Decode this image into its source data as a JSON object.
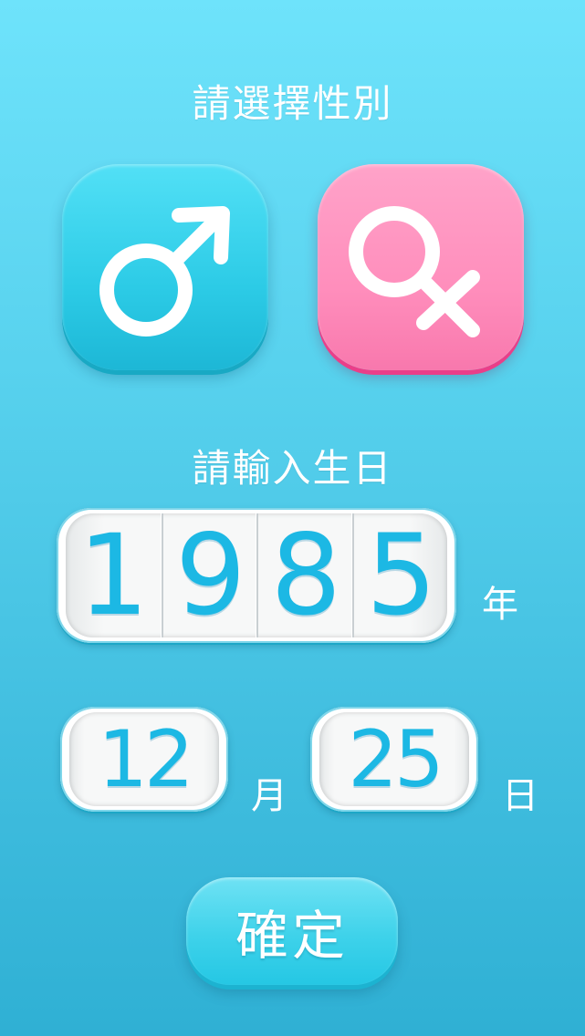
{
  "gender": {
    "title": "請選擇性別",
    "male_icon": "male-symbol",
    "female_icon": "female-symbol",
    "colors": {
      "male": "#2ccbe6",
      "female": "#ff8ebc"
    }
  },
  "birthday": {
    "title": "請輸入生日",
    "year_digits": [
      "1",
      "9",
      "8",
      "5"
    ],
    "year_unit": "年",
    "month": "12",
    "month_unit": "月",
    "day": "25",
    "day_unit": "日"
  },
  "confirm_label": "確定",
  "colors": {
    "background_top": "#6ee3fb",
    "background_bottom": "#2fb0d4",
    "digit": "#1cb8e4"
  }
}
